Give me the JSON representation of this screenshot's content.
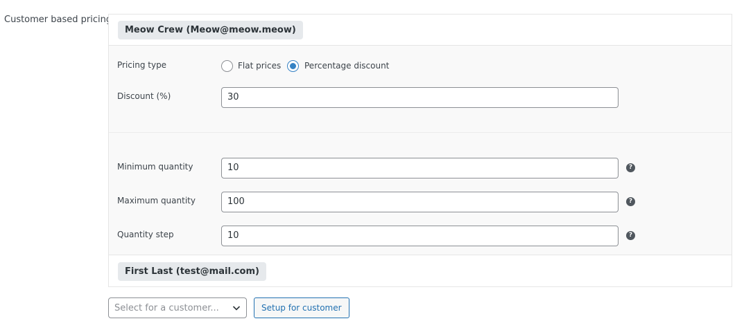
{
  "section": {
    "label": "Customer based pricing"
  },
  "customers": [
    {
      "name": "Meow Crew (Meow@meow.meow)",
      "pricing_type": {
        "label": "Pricing type",
        "options": [
          "Flat prices",
          "Percentage discount"
        ],
        "selected": "Percentage discount"
      },
      "discount": {
        "label": "Discount (%)",
        "value": "30"
      },
      "minimum_quantity": {
        "label": "Minimum quantity",
        "value": "10"
      },
      "maximum_quantity": {
        "label": "Maximum quantity",
        "value": "100"
      },
      "quantity_step": {
        "label": "Quantity step",
        "value": "10"
      }
    },
    {
      "name": "First Last (test@mail.com)"
    }
  ],
  "help_glyph": "?",
  "footer": {
    "select_placeholder": "Select for a customer...",
    "setup_button_label": "Setup for customer"
  },
  "colors": {
    "accent": "#3582c4",
    "button_text": "#2271b1",
    "chip_bg": "#e6e9ec"
  }
}
